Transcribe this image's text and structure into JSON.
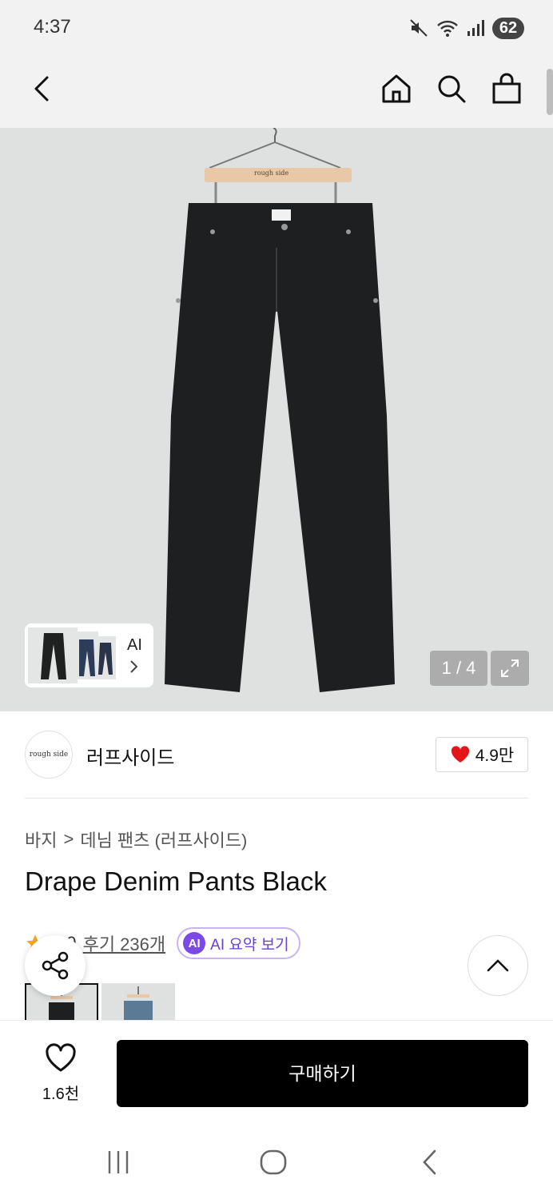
{
  "status_bar": {
    "time": "4:37",
    "battery": "62",
    "icons": [
      "mute-icon",
      "wifi-icon",
      "signal-icon"
    ]
  },
  "nav": {
    "icons": [
      "back-icon",
      "home-icon",
      "search-icon",
      "shopping-bag-icon"
    ]
  },
  "gallery": {
    "photo_label": "rough side",
    "thumb_ai_label": "AI",
    "counter": "1 / 4"
  },
  "brand": {
    "logo_text": "rough side",
    "name": "러프사이드",
    "likes": "4.9만"
  },
  "breadcrumb": {
    "category": "바지",
    "separator": ">",
    "sub": "데님 팬츠 (러프사이드)"
  },
  "product": {
    "title": "Drape Denim Pants Black"
  },
  "rating": {
    "score": "4.9",
    "reviews": "후기 236개",
    "ai_badge": "AI",
    "ai_summary": "AI 요약 보기"
  },
  "bottom": {
    "wish_count": "1.6천",
    "buy_label": "구매하기"
  },
  "colors": {
    "accent_purple": "#7b4ae6",
    "heart_red": "#e4141b",
    "buy_black": "#000000",
    "star_orange": "#f5a623"
  }
}
